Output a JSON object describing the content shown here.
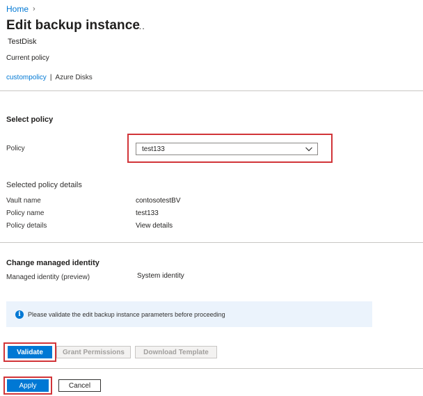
{
  "breadcrumb": {
    "home": "Home",
    "chevron": "›"
  },
  "header": {
    "title": "Edit backup instance",
    "more": "...",
    "subtitle": "TestDisk"
  },
  "current_policy": {
    "label": "Current policy",
    "policy_link": "custompolicy",
    "separator": "|",
    "datasource_type": "Azure Disks"
  },
  "select_policy": {
    "heading": "Select policy",
    "policy_label": "Policy",
    "policy_value": "test133",
    "chevron_icon": "chevron-down-icon"
  },
  "selected_policy_details": {
    "heading": "Selected policy details",
    "rows": [
      {
        "label": "Vault name",
        "value": "contosotestBV"
      },
      {
        "label": "Policy name",
        "value": "test133"
      },
      {
        "label": "Policy details",
        "value": "View details"
      }
    ]
  },
  "managed_identity": {
    "heading": "Change managed identity",
    "label": "Managed identity (preview)",
    "value": "System identity"
  },
  "info_bar": {
    "icon": "info-icon",
    "icon_glyph": "i",
    "message": "Please validate the edit backup instance parameters before proceeding"
  },
  "actions": {
    "validate": "Validate",
    "grant_permissions": "Grant Permissions",
    "download_template": "Download Template"
  },
  "footer": {
    "apply": "Apply",
    "cancel": "Cancel"
  },
  "colors": {
    "accent": "#0078d4",
    "highlight": "#d13438",
    "info_bg": "#ebf3fc"
  }
}
